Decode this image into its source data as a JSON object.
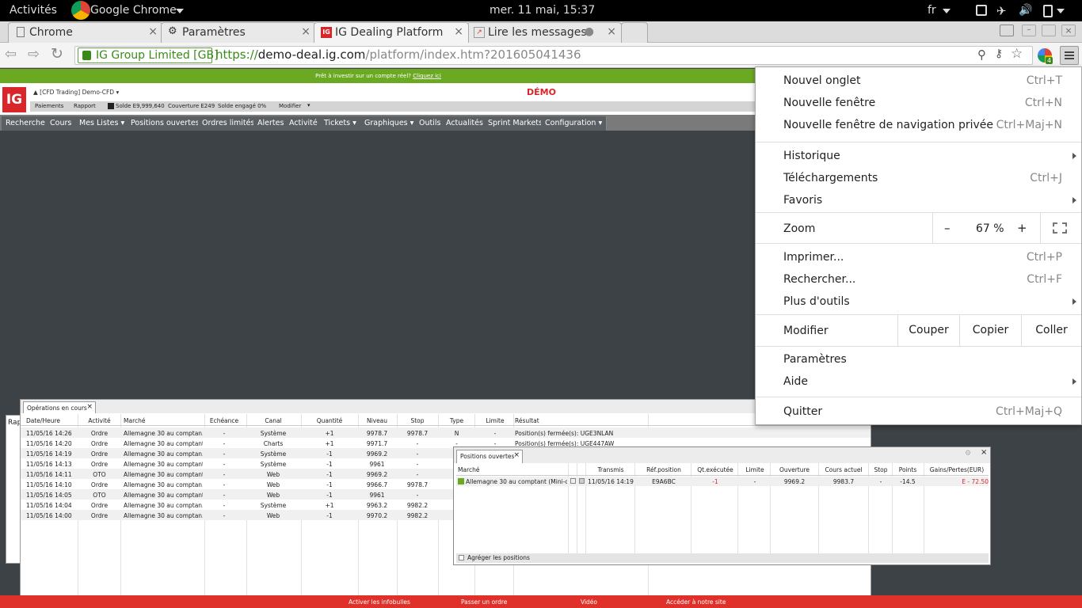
{
  "topbar": {
    "activities": "Activités",
    "app": "Google Chrome",
    "clock": "mer. 11 mai, 15:37",
    "lang": "fr"
  },
  "tabs": [
    {
      "label": "Chrome"
    },
    {
      "label": "Paramètres"
    },
    {
      "label": "IG Dealing Platform"
    },
    {
      "label": "Lire les messages"
    }
  ],
  "omnibox": {
    "ev": "IG Group Limited [GB]",
    "scheme": "https://",
    "domain": "demo-deal.ig.com",
    "path": "/platform/index.htm?201605041436",
    "ext_badge": "4"
  },
  "page": {
    "banner": "Prêt à investir sur un compte réel?",
    "banner_link": "Cliquez ici",
    "logo": "IG",
    "account": "[CFD Trading] Demo-CFD",
    "demo": "DÉMO",
    "sub": [
      "Paiements",
      "Rapport"
    ],
    "balance": "Solde  E9,999,640",
    "cover": "Couverture  E249",
    "engaged": "Solde engagé  0%",
    "modify": "Modifier",
    "nav": [
      "Recherche",
      "Cours",
      "Mes Listes",
      "Positions ouvertes",
      "Ordres limités",
      "Alertes",
      "Activité",
      "Tickets",
      "Graphiques",
      "Outils",
      "Actualités",
      "Sprint Markets",
      "Configuration"
    ]
  },
  "ops": {
    "tab": "Opérations en cours",
    "side_label": "Rap",
    "headers": [
      "Date/Heure",
      "Activité",
      "Marché",
      "Echéance",
      "Canal",
      "Quantité",
      "Niveau",
      "Stop",
      "Type",
      "Limite",
      "Résultat"
    ],
    "rows": [
      [
        "11/05/16 14:26",
        "Ordre",
        "Allemagne 30 au comptan...",
        "-",
        "Système",
        "+1",
        "9978.7",
        "9978.7",
        "N",
        "-",
        "Position(s) fermée(s): UGE3NLAN"
      ],
      [
        "11/05/16 14:20",
        "Ordre",
        "Allemagne 30 au comptant",
        "-",
        "Charts",
        "+1",
        "9971.7",
        "-",
        "-",
        "-",
        "Position(s) fermée(s): UGE447AW"
      ],
      [
        "11/05/16 14:19",
        "Ordre",
        "Allemagne 30 au comptan...",
        "-",
        "Système",
        "-1",
        "9969.2",
        "-",
        "",
        "",
        ""
      ],
      [
        "11/05/16 14:13",
        "Ordre",
        "Allemagne 30 au comptant",
        "-",
        "Système",
        "-1",
        "9961",
        "-",
        "",
        "",
        ""
      ],
      [
        "11/05/16 14:11",
        "OTO",
        "Allemagne 30 au comptant",
        "-",
        "Web",
        "-1",
        "9969.2",
        "-",
        "",
        "",
        ""
      ],
      [
        "11/05/16 14:10",
        "Ordre",
        "Allemagne 30 au comptan...",
        "-",
        "Web",
        "-1",
        "9966.7",
        "9978.7",
        "",
        "",
        ""
      ],
      [
        "11/05/16 14:05",
        "OTO",
        "Allemagne 30 au comptant",
        "-",
        "Web",
        "-1",
        "9961",
        "-",
        "",
        "",
        ""
      ],
      [
        "11/05/16 14:04",
        "Ordre",
        "Allemagne 30 au comptan...",
        "-",
        "Système",
        "+1",
        "9963.2",
        "9982.2",
        "",
        "",
        ""
      ],
      [
        "11/05/16 14:00",
        "Ordre",
        "Allemagne 30 au comptan...",
        "-",
        "Web",
        "-1",
        "9970.2",
        "9982.2",
        "",
        "",
        ""
      ]
    ]
  },
  "positions": {
    "tab": "Positions ouvertes",
    "headers": [
      "Marché",
      "Transmis",
      "Réf.position",
      "Qt.exécutée",
      "Limite",
      "Ouverture",
      "Cours actuel",
      "Stop",
      "Points",
      "Gains/Pertes(EUR)"
    ],
    "row": [
      "Allemagne 30 au comptant (Mini-c...",
      "11/05/16 14:19",
      "E9A6BC",
      "-1",
      "-",
      "9969.2",
      "9983.7",
      "-",
      "-14.5",
      "E - 72.50"
    ],
    "aggregate": "Agréger les positions"
  },
  "footer": [
    "Activer les infobulles",
    "Passer un ordre",
    "Vidéo",
    "Accéder à notre site"
  ],
  "menu": {
    "new_tab": "Nouvel onglet",
    "new_tab_sc": "Ctrl+T",
    "new_window": "Nouvelle fenêtre",
    "new_window_sc": "Ctrl+N",
    "incognito": "Nouvelle fenêtre de navigation privée",
    "incognito_sc": "Ctrl+Maj+N",
    "history": "Historique",
    "downloads": "Téléchargements",
    "downloads_sc": "Ctrl+J",
    "bookmarks": "Favoris",
    "zoom": "Zoom",
    "zoom_minus": "–",
    "zoom_value": "67 %",
    "zoom_plus": "+",
    "print": "Imprimer...",
    "print_sc": "Ctrl+P",
    "find": "Rechercher...",
    "find_sc": "Ctrl+F",
    "more_tools": "Plus d'outils",
    "edit": "Modifier",
    "cut": "Couper",
    "copy": "Copier",
    "paste": "Coller",
    "settings": "Paramètres",
    "help": "Aide",
    "quit": "Quitter",
    "quit_sc": "Ctrl+Maj+Q"
  },
  "colors": {
    "ig_red": "#d8262b",
    "green": "#6ca923",
    "footer_red": "#e0302a"
  }
}
